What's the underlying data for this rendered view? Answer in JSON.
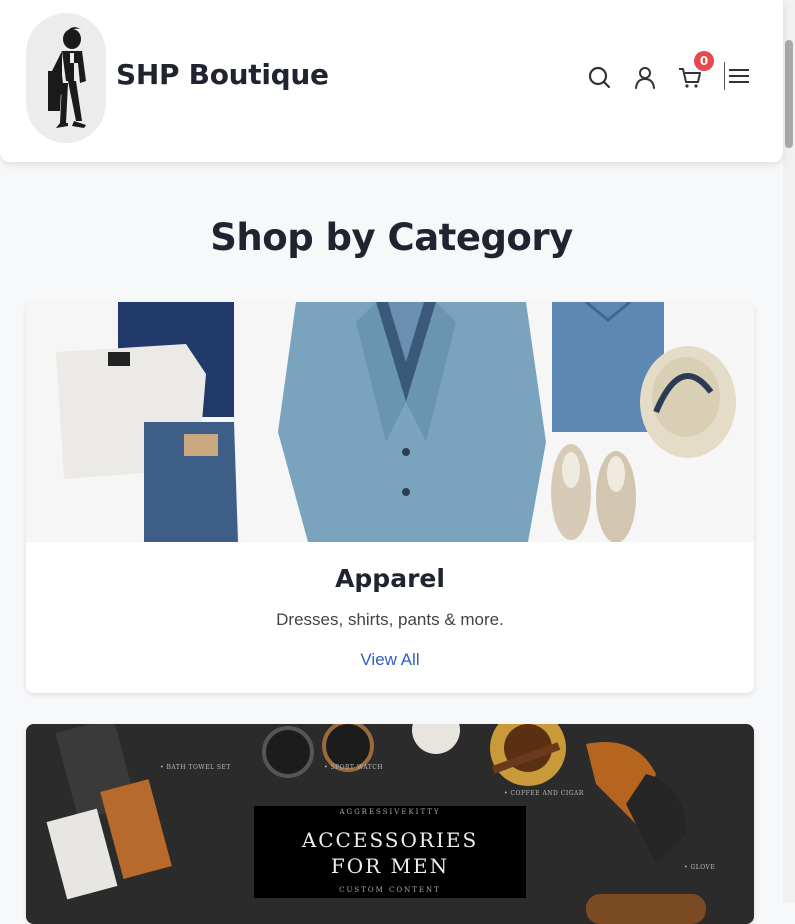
{
  "header": {
    "brand": "SHP Boutique",
    "cart_count": "0",
    "icons": [
      "search-icon",
      "user-icon",
      "cart-icon",
      "menu-icon"
    ]
  },
  "section": {
    "title": "Shop by Category"
  },
  "categories": [
    {
      "title": "Apparel",
      "description": "Dresses, shirts, pants & more.",
      "link": "View All"
    },
    {
      "banner_brand": "AGGRESSIVEKITTY",
      "banner_line1": "ACCESSORIES",
      "banner_line2": "FOR MEN",
      "banner_sub": "CUSTOM CONTENT",
      "labels": [
        "• BATH TOWEL SET",
        "• SPORT WATCH",
        "• COFFEE AND CIGAR",
        "• GLOVE"
      ]
    }
  ],
  "colors": {
    "accent_link": "#2c5fc7",
    "badge": "#e5484d",
    "text": "#1f2430"
  }
}
